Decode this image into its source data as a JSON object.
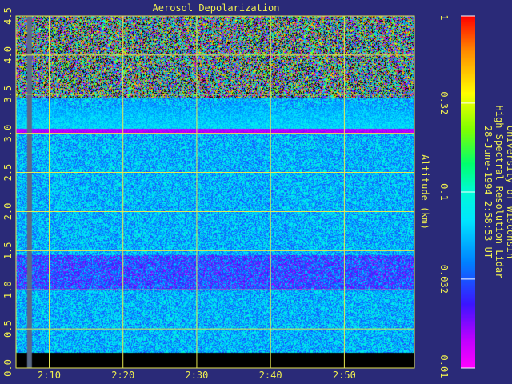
{
  "chart_data": {
    "type": "heatmap",
    "title": "Aerosol Depolarization",
    "ylabel": "Altitude (km)",
    "xlabel": "",
    "x_ticks": [
      "2:10",
      "2:20",
      "2:30",
      "2:40",
      "2:50"
    ],
    "y_ticks": [
      "0.0",
      "0.5",
      "1.0",
      "1.5",
      "2.0",
      "2.5",
      "3.0",
      "3.5",
      "4.0",
      "4.5"
    ],
    "ylim": [
      0,
      4.5
    ],
    "grid": true,
    "colorbar": {
      "scale": "log",
      "range": [
        0.01,
        1
      ],
      "ticks": [
        "0.01",
        "0.032",
        "0.1",
        "0.32",
        "1"
      ]
    },
    "features": {
      "cloud_top_km": 3.0,
      "cloud_band_km": [
        3.0,
        3.35
      ],
      "enhanced_layer_km": [
        1.0,
        1.45
      ],
      "blocked_below_km": 0.2,
      "noise_above_km": 3.4
    },
    "credits": {
      "line1": "University of Wisconsin",
      "line2": "High Spectral Resolution Lidar",
      "line3": "28-June-1994  2:58:53 UT"
    }
  },
  "colors": {
    "background": "#2a2a78",
    "text": "#f0f050",
    "grid": "#e6e650",
    "blocked": "#000000"
  }
}
